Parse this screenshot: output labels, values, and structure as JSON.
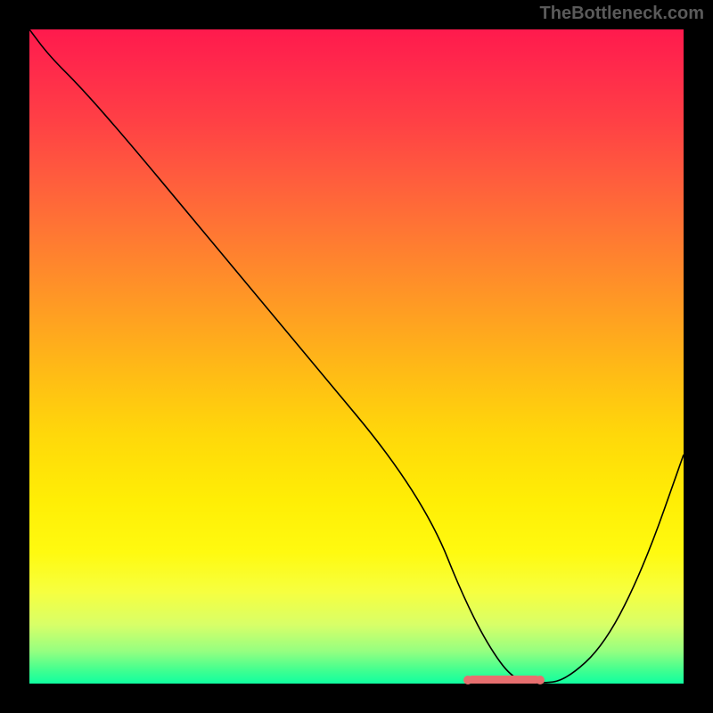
{
  "watermark": "TheBottleneck.com",
  "chart_data": {
    "type": "line",
    "title": "",
    "xlabel": "",
    "ylabel": "",
    "xlim": [
      0,
      100
    ],
    "ylim": [
      0,
      100
    ],
    "x": [
      0,
      3,
      8,
      15,
      25,
      35,
      45,
      55,
      62,
      66,
      70,
      74,
      78,
      82,
      88,
      94,
      100
    ],
    "values": [
      100,
      96,
      91,
      83,
      71,
      59,
      47,
      35,
      24,
      14,
      6,
      0.5,
      0,
      0.5,
      6,
      18,
      35
    ],
    "optimal_range": {
      "start_pct": 67,
      "end_pct": 78,
      "value": 0
    },
    "gradient_stops": [
      {
        "pct": 0,
        "color": "#ff1a4d"
      },
      {
        "pct": 50,
        "color": "#ffd000"
      },
      {
        "pct": 100,
        "color": "#10ffa0"
      }
    ]
  }
}
